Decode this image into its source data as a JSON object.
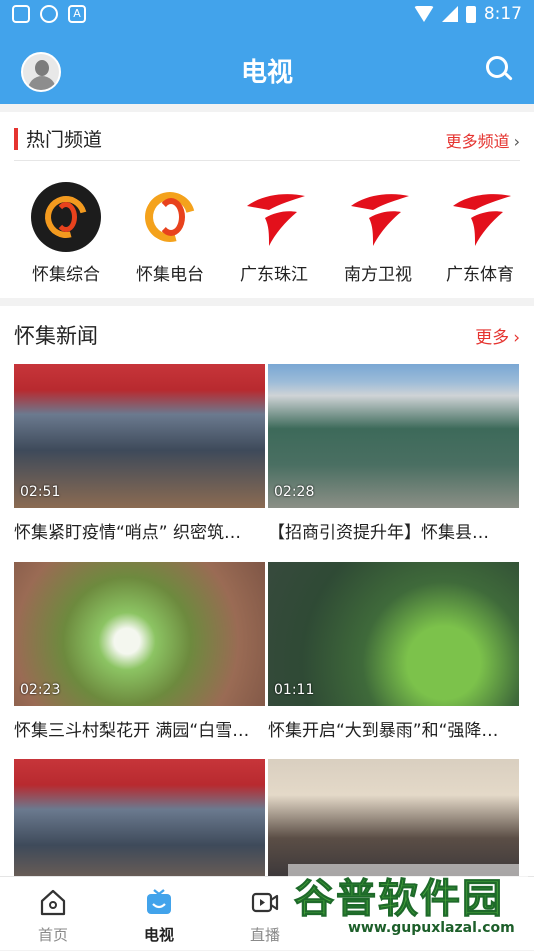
{
  "status_bar": {
    "time": "8:17",
    "battery_icon": "battery-charging-icon",
    "wifi_icon": "wifi-icon",
    "signal_icon": "signal-icon"
  },
  "header": {
    "title": "电视",
    "avatar_icon": "avatar-icon",
    "search_icon": "search-icon"
  },
  "hot_channels": {
    "title": "热门频道",
    "more_label": "更多频道",
    "items": [
      {
        "name": "怀集综合",
        "logo": "huaiji-logo-dark"
      },
      {
        "name": "怀集电台",
        "logo": "huaiji-logo-orange"
      },
      {
        "name": "广东珠江",
        "logo": "guangdong-tv-logo"
      },
      {
        "name": "南方卫视",
        "logo": "guangdong-tv-logo"
      },
      {
        "name": "广东体育",
        "logo": "guangdong-tv-logo"
      }
    ]
  },
  "news": {
    "title": "怀集新闻",
    "more_label": "更多",
    "items": [
      {
        "duration": "02:51",
        "caption": "怀集紧盯疫情“哨点” 织密筑…"
      },
      {
        "duration": "02:28",
        "caption": "【招商引资提升年】怀集县…"
      },
      {
        "duration": "02:23",
        "caption": "怀集三斗村梨花开 满园“白雪…"
      },
      {
        "duration": "01:11",
        "caption": "怀集开启“大到暴雨”和“强降…"
      },
      {
        "duration": "",
        "caption": ""
      },
      {
        "duration": "",
        "caption": ""
      }
    ]
  },
  "tabbar": {
    "items": [
      {
        "label": "首页",
        "icon": "home-icon"
      },
      {
        "label": "电视",
        "icon": "tv-icon"
      },
      {
        "label": "直播",
        "icon": "live-video-icon"
      }
    ]
  },
  "watermark": {
    "text": "谷普软件园",
    "url": "www.gupuxlazal.com"
  },
  "colors": {
    "brand": "#42a3eb",
    "accent_red": "#e53430"
  }
}
